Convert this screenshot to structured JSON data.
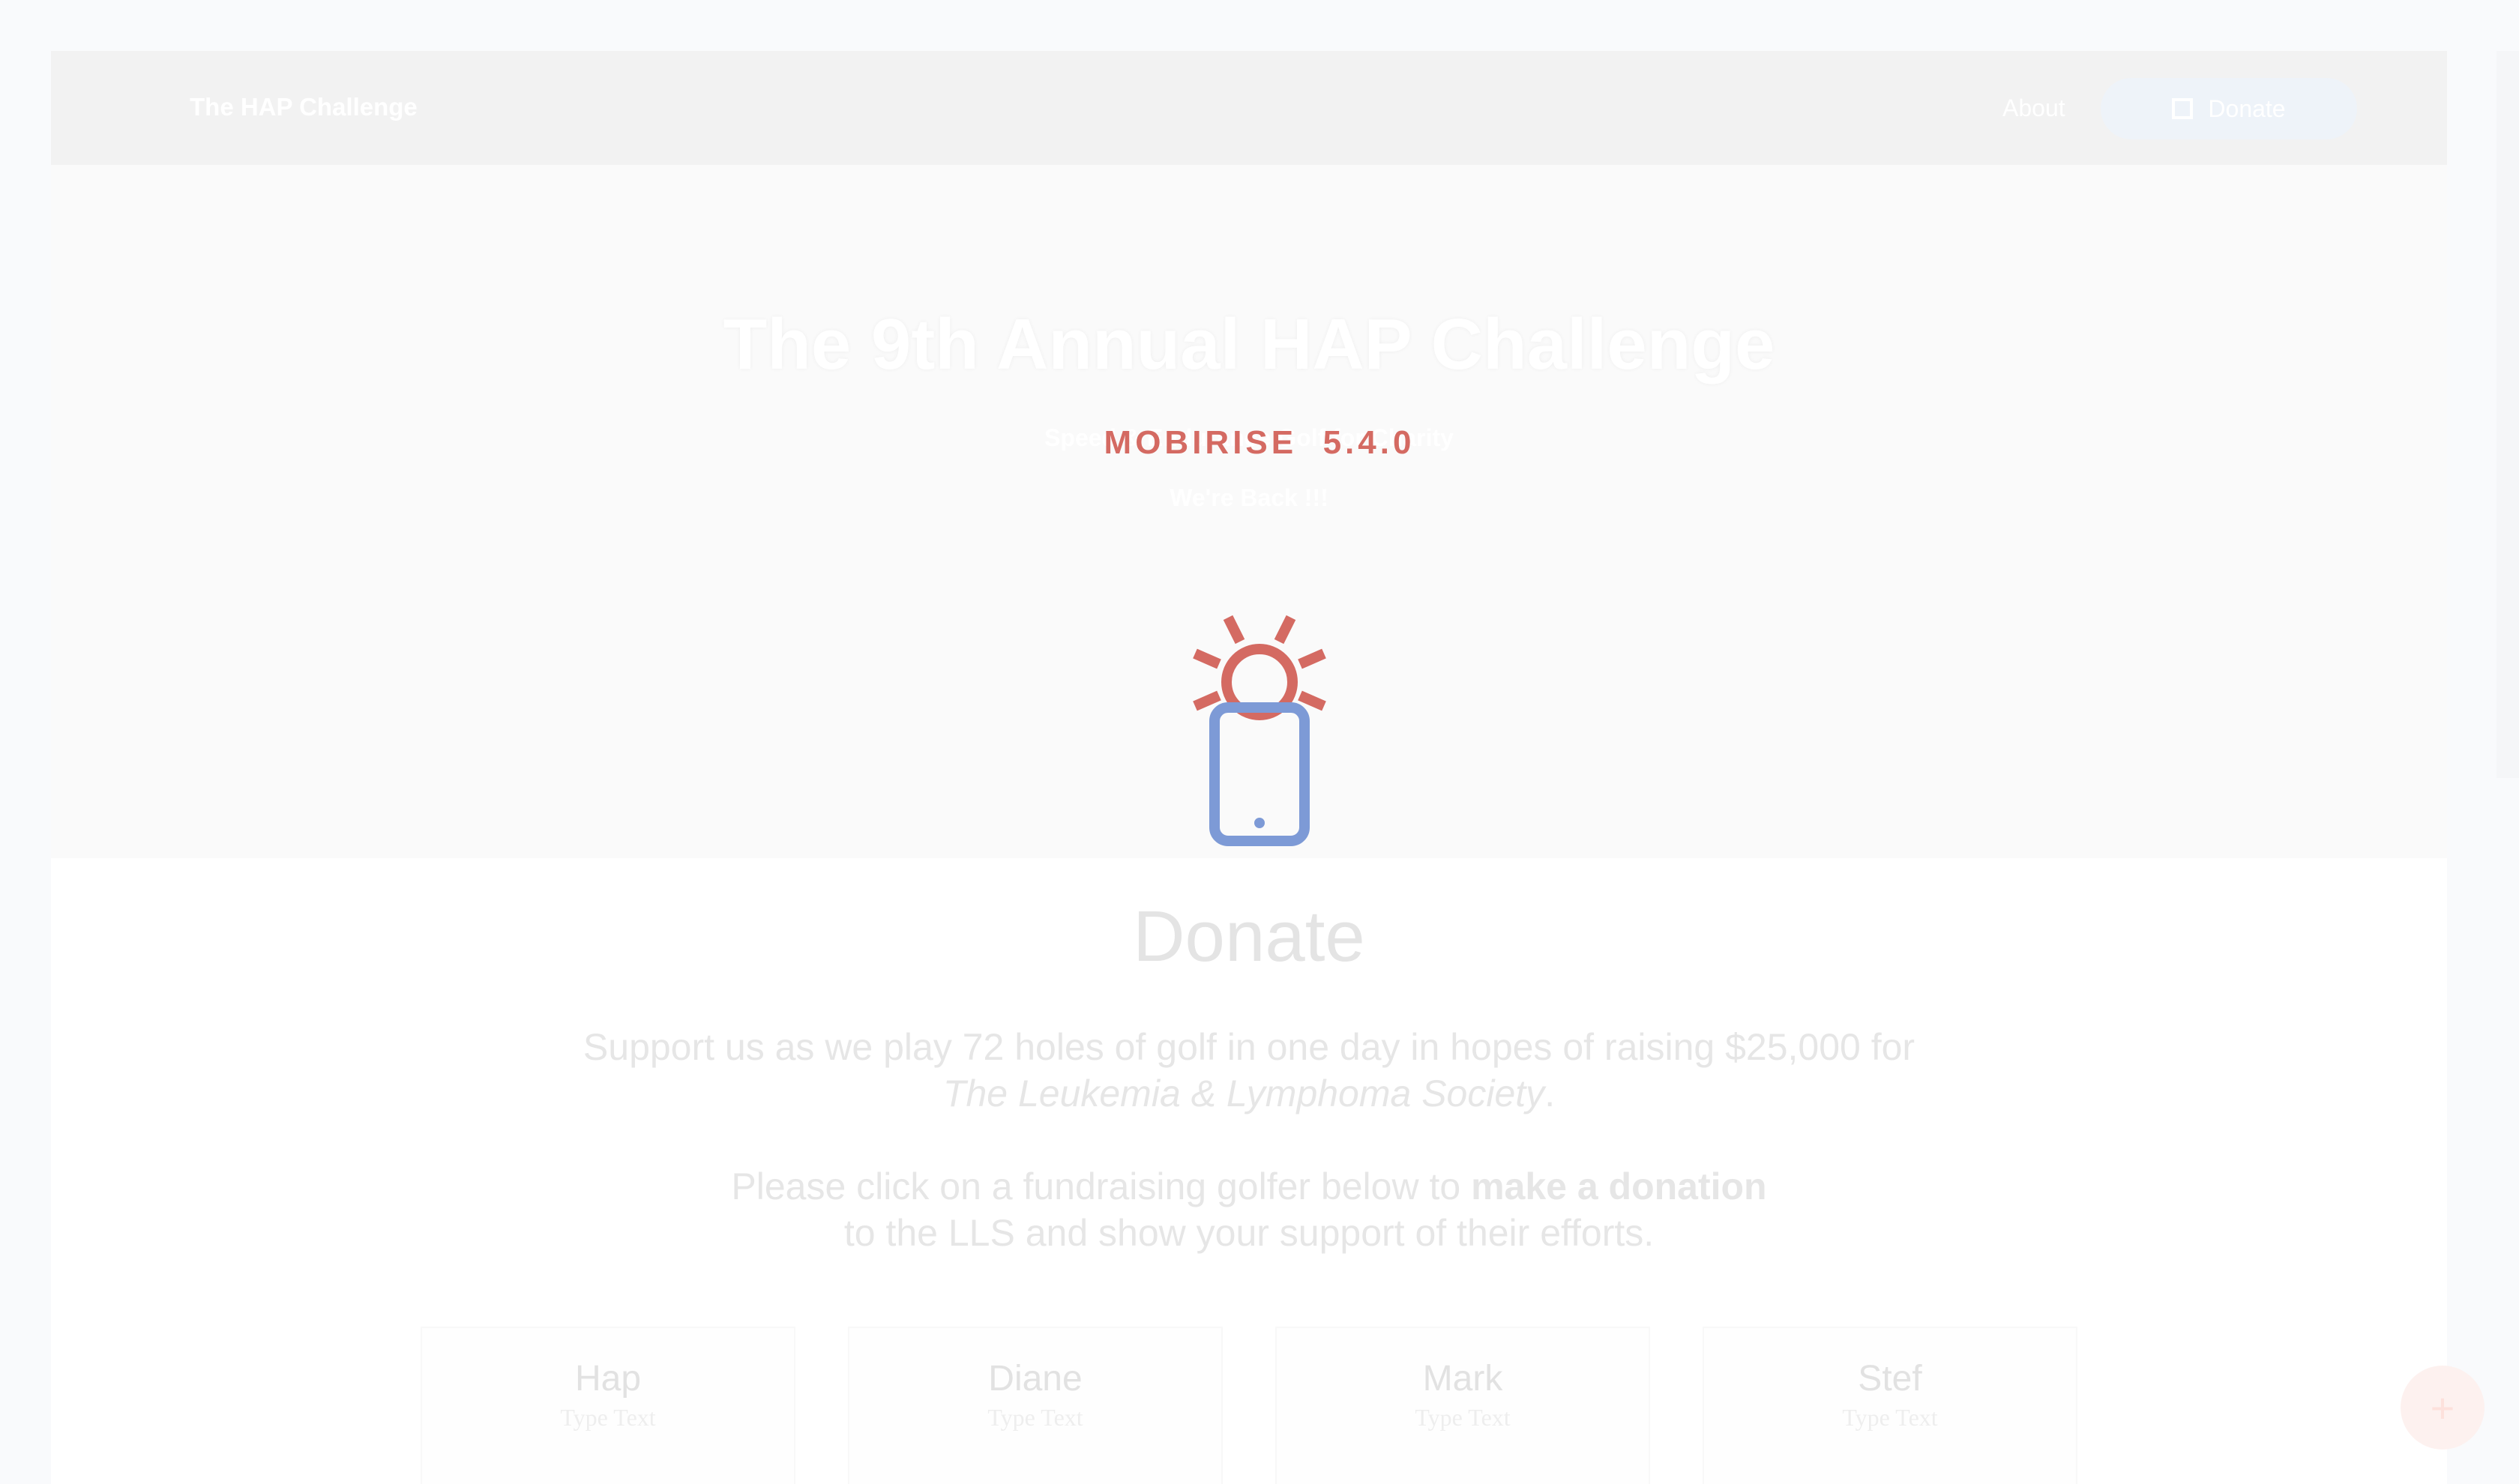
{
  "navbar": {
    "brand": "The HAP Challenge",
    "about_label": "About",
    "donate_label": "Donate"
  },
  "hero": {
    "title": "The 9th Annual HAP Challenge",
    "subtitle": "Speed & Endurance Golf for Charity",
    "subtitle2": "We're Back !!!"
  },
  "overlay": {
    "product": "MOBIRISE",
    "version": "5.4.0",
    "logo_icon": "mobirise-phone-sun-icon"
  },
  "donate": {
    "heading": "Donate",
    "line1": "Support us as we play 72 holes of golf in one day in hopes of raising $25,000 for",
    "line1_italic": "The Leukemia & Lymphoma Society",
    "line1_end": ".",
    "line2_prefix": "Please click on a fundraising golfer below to ",
    "line2_bold": "make a donation",
    "line3": "to the LLS and show your support of their efforts."
  },
  "golfers": [
    {
      "name": "Hap",
      "text": "Type Text"
    },
    {
      "name": "Diane",
      "text": "Type Text"
    },
    {
      "name": "Mark",
      "text": "Type Text"
    },
    {
      "name": "Stef",
      "text": "Type Text"
    }
  ],
  "fab": {
    "icon": "plus-icon"
  },
  "colors": {
    "accent_red": "#d46a62",
    "accent_blue": "#7d9ad6",
    "navbar_bg": "#f2f2f2"
  }
}
